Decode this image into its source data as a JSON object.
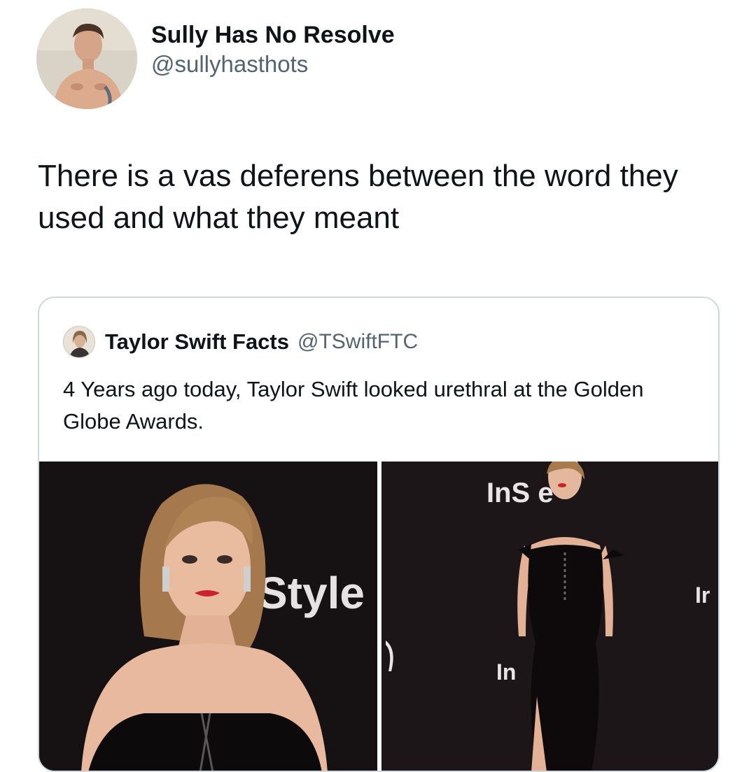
{
  "author": {
    "display_name": "Sully Has No Resolve",
    "handle": "@sullyhasthots",
    "avatar_icon": "profile-photo-icon"
  },
  "tweet": {
    "text": "There is a vas deferens between the word they used and what they meant"
  },
  "quoted_tweet": {
    "display_name": "Taylor Swift Facts",
    "handle": "@TSwiftFTC",
    "avatar_icon": "profile-photo-icon",
    "text": "4 Years ago today, Taylor Swift looked urethral at the Golden Globe Awards."
  },
  "media": {
    "left_photo_backdrop_text": "Style",
    "left_photo_backdrop_text_2": "le",
    "right_photo_backdrop_text": "InS e",
    "right_photo_backdrop_text_2": "In",
    "right_photo_backdrop_text_3": "Ir",
    "colors": {
      "backdrop": "#171214",
      "skin": "#e8b89f",
      "hair": "#a87b4f",
      "dress": "#0d0a0b",
      "lips": "#c8242a"
    }
  }
}
